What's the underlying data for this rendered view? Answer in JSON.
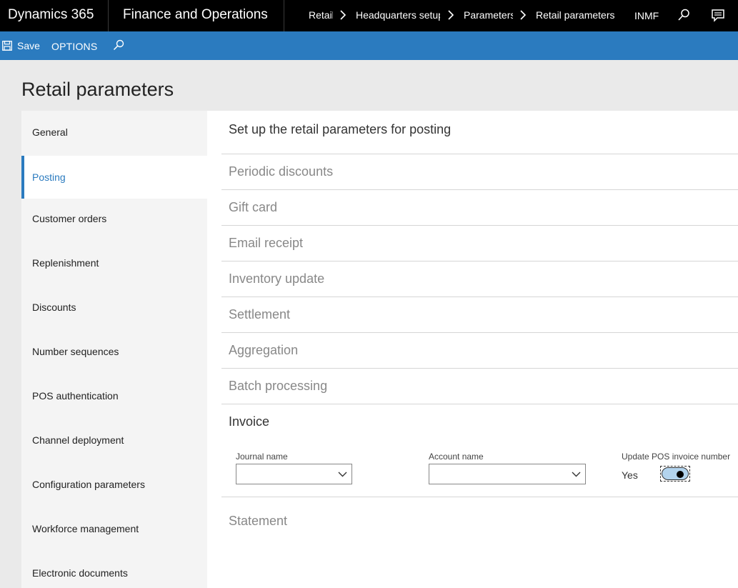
{
  "topbar": {
    "brand": "Dynamics 365",
    "app_name": "Finance and Operations",
    "breadcrumbs": [
      "Retail",
      "Headquarters setup",
      "Parameters",
      "Retail parameters"
    ],
    "company": "INMF"
  },
  "actionbar": {
    "save_label": "Save",
    "options_label": "OPTIONS"
  },
  "page": {
    "title": "Retail parameters"
  },
  "sidenav": {
    "items": [
      {
        "label": "General"
      },
      {
        "label": "Posting"
      },
      {
        "label": "Customer orders"
      },
      {
        "label": "Replenishment"
      },
      {
        "label": "Discounts"
      },
      {
        "label": "Number sequences"
      },
      {
        "label": "POS authentication"
      },
      {
        "label": "Channel deployment"
      },
      {
        "label": "Configuration parameters"
      },
      {
        "label": "Workforce management"
      },
      {
        "label": "Electronic documents"
      }
    ],
    "active": "Posting"
  },
  "main": {
    "heading": "Set up the retail parameters for posting",
    "sections": [
      {
        "title": "Periodic discounts"
      },
      {
        "title": "Gift card"
      },
      {
        "title": "Email receipt"
      },
      {
        "title": "Inventory update"
      },
      {
        "title": "Settlement"
      },
      {
        "title": "Aggregation"
      },
      {
        "title": "Batch processing"
      },
      {
        "title": "Invoice"
      },
      {
        "title": "Statement"
      }
    ],
    "invoice": {
      "journal_name_label": "Journal name",
      "journal_name_value": "",
      "account_name_label": "Account name",
      "account_name_value": "",
      "update_pos_label": "Update POS invoice number",
      "update_pos_value": "Yes",
      "update_pos_on": true
    }
  },
  "colors": {
    "topbar_bg": "#000000",
    "actionbar_bg": "#2b7bbf",
    "accent": "#2b7bbf",
    "toggle_track": "#b3d4ee"
  },
  "icons": [
    "save-icon",
    "search-icon",
    "chevron-right-icon",
    "chat-icon",
    "chevron-down-icon"
  ]
}
